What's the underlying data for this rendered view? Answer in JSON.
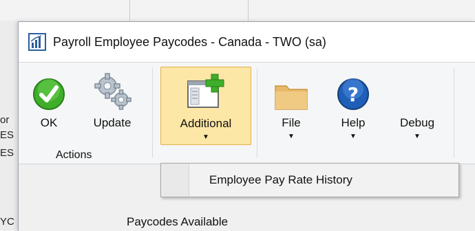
{
  "window": {
    "title": "Payroll Employee Paycodes - Canada  -  TWO (sa)"
  },
  "background": {
    "fragments": [
      "or",
      "ES",
      "ES",
      "YC"
    ]
  },
  "ribbon": {
    "buttons": [
      {
        "label": "OK",
        "icon": "green-check-icon"
      },
      {
        "label": "Update",
        "icon": "gears-icon"
      },
      {
        "label": "Additional",
        "icon": "window-plus-icon",
        "has_dropdown": true,
        "state": "active"
      },
      {
        "label": "File",
        "icon": "folder-icon",
        "has_dropdown": true
      },
      {
        "label": "Help",
        "icon": "help-icon",
        "has_dropdown": true
      },
      {
        "label": "Debug",
        "icon": "",
        "has_dropdown": true
      }
    ],
    "groups": [
      {
        "label": "Actions"
      }
    ]
  },
  "dropdown": {
    "items": [
      {
        "label": "Employee Pay Rate History"
      }
    ]
  },
  "content": {
    "section_label": "Paycodes Available"
  },
  "colors": {
    "accent_active": "#fde7a6",
    "accent_border": "#e3b04b",
    "ok_green": "#3fae2a",
    "help_blue": "#1f5fb8",
    "folder_tan": "#e8b96a"
  }
}
